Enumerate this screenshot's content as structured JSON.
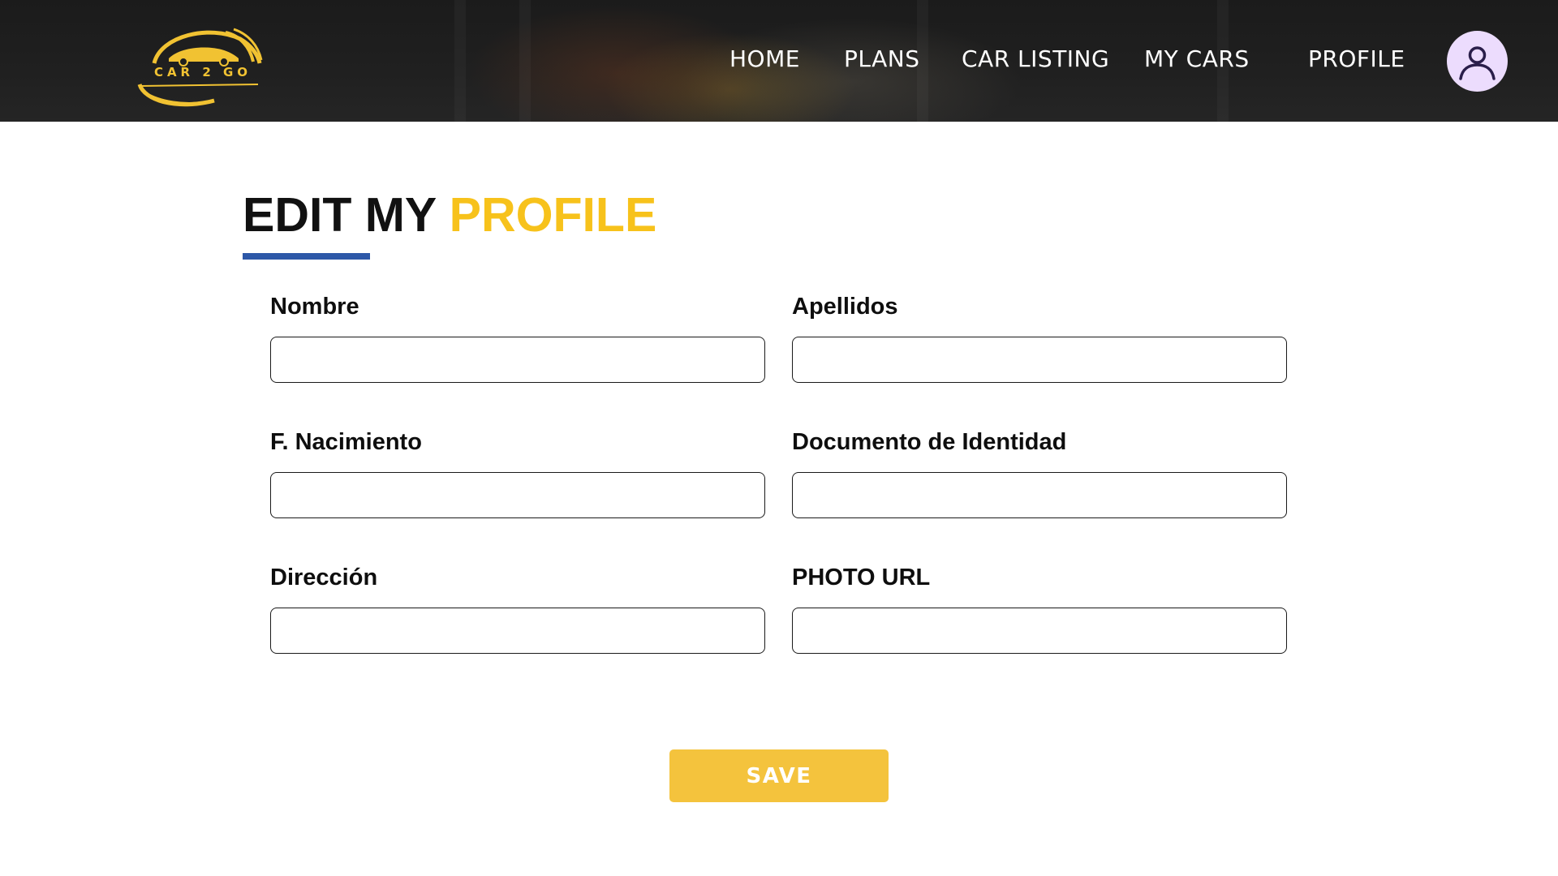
{
  "header": {
    "logo_text": "CAR 2 GO",
    "nav": {
      "home": "HOME",
      "plans": "PLANS",
      "car_listing": "CAR LISTING",
      "my_cars": "MY CARS",
      "profile": "PROFILE"
    },
    "avatar_icon": "user-icon"
  },
  "main": {
    "title_part1": "EDIT MY",
    "title_part2": "PROFILE"
  },
  "form": {
    "fields": {
      "nombre": {
        "label": "Nombre",
        "value": "",
        "placeholder": ""
      },
      "apellidos": {
        "label": "Apellidos",
        "value": "",
        "placeholder": ""
      },
      "nacimiento": {
        "label": "F. Nacimiento",
        "value": "",
        "placeholder": ""
      },
      "documento": {
        "label": "Documento de Identidad",
        "value": "",
        "placeholder": ""
      },
      "direccion": {
        "label": "Dirección",
        "value": "",
        "placeholder": ""
      },
      "photo_url": {
        "label": "PHOTO URL",
        "value": "",
        "placeholder": ""
      }
    },
    "save_label": "SAVE"
  },
  "colors": {
    "accent_yellow": "#f7c21b",
    "button_yellow": "#f4c33d",
    "underline_blue": "#2d58a8",
    "avatar_bg": "#ecdcfd",
    "header_bg": "#1f1f1f"
  }
}
